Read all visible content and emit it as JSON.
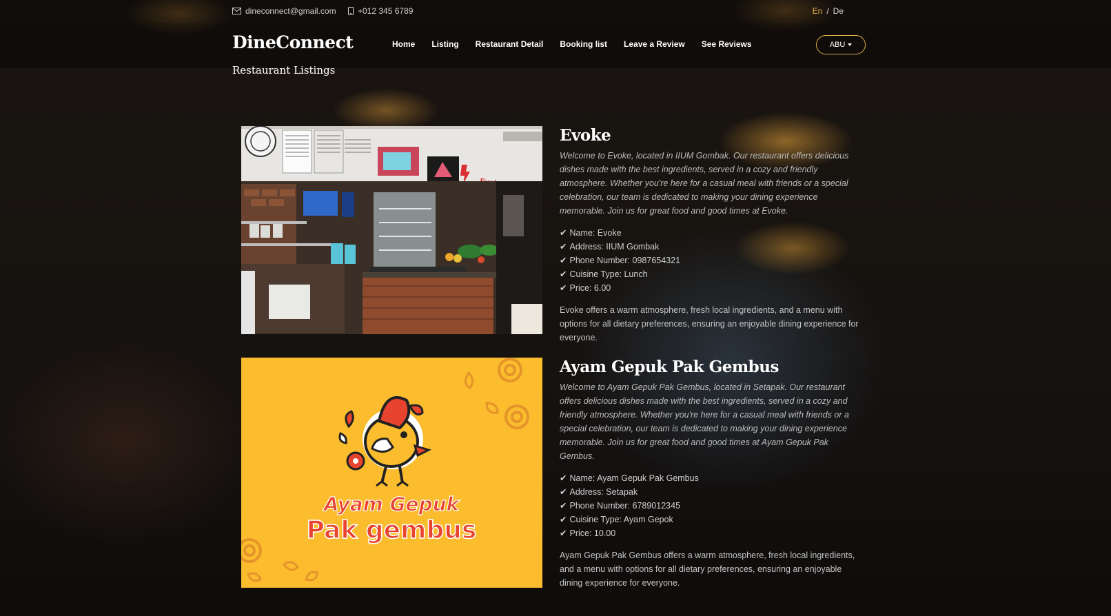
{
  "topbar": {
    "email": "dineconnect@gmail.com",
    "phone": "+012 345 6789",
    "lang_en": "En",
    "lang_sep": "/",
    "lang_de": "De"
  },
  "brand": "DineConnect",
  "nav": [
    "Home",
    "Listing",
    "Restaurant Detail",
    "Booking list",
    "Leave a Review",
    "See Reviews"
  ],
  "user_menu": "ABU",
  "page_title": "Restaurant Listings",
  "restaurants": [
    {
      "name": "Evoke",
      "description": "Welcome to Evoke, located in IIUM Gombak. Our restaurant offers delicious dishes made with the best ingredients, served in a cozy and friendly atmosphere. Whether you're here for a casual meal with friends or a special celebration, our team is dedicated to making your dining experience memorable. Join us for great food and good times at Evoke.",
      "facts": [
        "Name: Evoke",
        "Address: IIUM Gombak",
        "Phone Number: 0987654321",
        "Cuisine Type: Lunch",
        "Price: 6.00"
      ],
      "extra": "Evoke offers a warm atmosphere, fresh local ingredients, and a menu with options for all dietary preferences, ensuring an enjoyable dining experience for everyone.",
      "image_sign": "Evoke I Cafe"
    },
    {
      "name": "Ayam Gepuk Pak Gembus",
      "description": "Welcome to Ayam Gepuk Pak Gembus, located in Setapak. Our restaurant offers delicious dishes made with the best ingredients, served in a cozy and friendly atmosphere. Whether you're here for a casual meal with friends or a special celebration, our team is dedicated to making your dining experience memorable. Join us for great food and good times at Ayam Gepuk Pak Gembus.",
      "facts": [
        "Name: Ayam Gepuk Pak Gembus",
        "Address: Setapak",
        "Phone Number: 6789012345",
        "Cuisine Type: Ayam Gepok",
        "Price: 10.00"
      ],
      "extra": "Ayam Gepuk Pak Gembus offers a warm atmosphere, fresh local ingredients, and a menu with options for all dietary preferences, ensuring an enjoyable dining experience for everyone.",
      "logo_line1": "Ayam Gepuk",
      "logo_line2": "Pak gembus"
    }
  ],
  "colors": {
    "accent": "#e0b04a",
    "logo_yellow": "#fbbd2e",
    "logo_red": "#e8432e"
  }
}
